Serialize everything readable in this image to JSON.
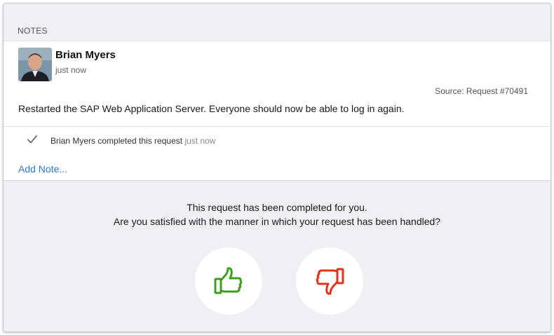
{
  "notes": {
    "section_title": "NOTES",
    "items": [
      {
        "author": "Brian Myers",
        "time": "just now",
        "source": "Source: Request #70491",
        "body": "Restarted the SAP Web Application Server. Everyone should now be able to log in again."
      }
    ],
    "activity": {
      "text": "Brian Myers completed this request",
      "time": "just now",
      "icon": "checkmark-icon"
    },
    "add_note_label": "Add Note..."
  },
  "feedback": {
    "line1": "This request has been completed for you.",
    "line2": "Are you satisfied with the manner in which your request has been handled?",
    "thumbs_up_icon": "thumbs-up-icon",
    "thumbs_down_icon": "thumbs-down-icon",
    "up_color": "#3f9e22",
    "down_color": "#e0331e"
  }
}
